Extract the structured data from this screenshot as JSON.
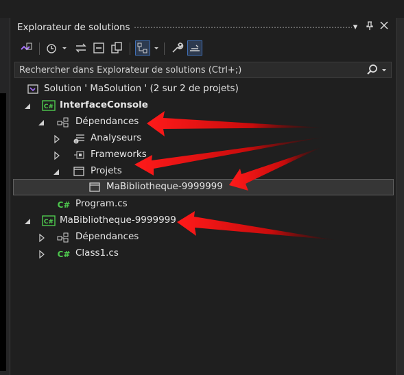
{
  "panel": {
    "title": "Explorateur de solutions",
    "search_placeholder": "Rechercher dans Explorateur de solutions (Ctrl+;)"
  },
  "tree": {
    "solution": "Solution ' MaSolution ' (2 sur 2 de projets)",
    "project1": "InterfaceConsole",
    "dependances1": "Dépendances",
    "analyseurs": "Analyseurs",
    "frameworks": "Frameworks",
    "projets": "Projets",
    "ref_bibliotheque": "MaBibliotheque-9999999",
    "program": "Program.cs",
    "project2": "MaBibliotheque-9999999",
    "dependances2": "Dépendances",
    "class1": "Class1.cs"
  },
  "colors": {
    "background": "#1f1f1f",
    "csharp_green": "#4ec94e",
    "vs_purple": "#a370f7",
    "annotation_red": "#e01010"
  }
}
